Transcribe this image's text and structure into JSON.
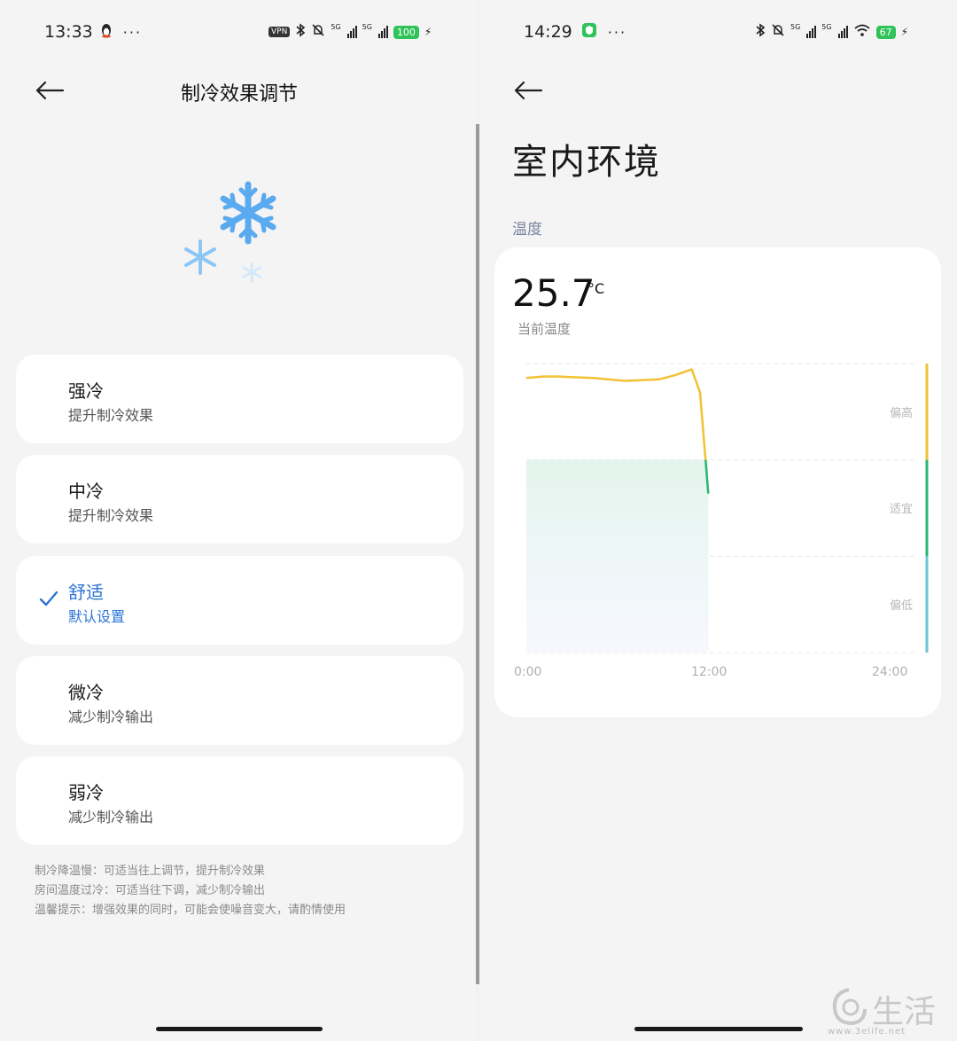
{
  "left": {
    "status": {
      "time": "13:33",
      "vpn": "VPN",
      "net1": "5G",
      "net2": "5G",
      "battery": "100"
    },
    "title": "制冷效果调节",
    "options": [
      {
        "title": "强冷",
        "subtitle": "提升制冷效果",
        "selected": false
      },
      {
        "title": "中冷",
        "subtitle": "提升制冷效果",
        "selected": false
      },
      {
        "title": "舒适",
        "subtitle": "默认设置",
        "selected": true
      },
      {
        "title": "微冷",
        "subtitle": "减少制冷输出",
        "selected": false
      },
      {
        "title": "弱冷",
        "subtitle": "减少制冷输出",
        "selected": false
      }
    ],
    "tips": [
      "制冷降温慢：可适当往上调节，提升制冷效果",
      "房间温度过冷：可适当往下调，减少制冷输出",
      "温馨提示：增强效果的同时，可能会使噪音变大，请酌情使用"
    ],
    "accent": "#2b74d6"
  },
  "right": {
    "status": {
      "time": "14:29",
      "net1": "5G",
      "net2": "5G",
      "battery": "67"
    },
    "title": "室内环境",
    "section": "温度",
    "current_temp": "25.7",
    "unit": "°C",
    "caption": "当前温度",
    "bands": [
      "偏高",
      "适宜",
      "偏低"
    ],
    "x_ticks": [
      "0:00",
      "12:00",
      "24:00"
    ],
    "colors": {
      "high": "#f1c232",
      "ok": "#2bb673",
      "low": "#6cc6d8"
    }
  },
  "chart_data": {
    "type": "line",
    "x": [
      "0:00",
      "1:00",
      "2:00",
      "4:00",
      "6:00",
      "8:00",
      "9:00",
      "10:00",
      "10:30",
      "11:00"
    ],
    "series": [
      {
        "values": [
          0.95,
          0.955,
          0.955,
          0.95,
          0.94,
          0.945,
          0.96,
          0.98,
          0.9,
          0.55
        ]
      }
    ],
    "x_range": [
      "0:00",
      "24:00"
    ],
    "bands": [
      "偏高",
      "适宜",
      "偏低"
    ],
    "grid": true
  },
  "watermark": {
    "text": "生活",
    "url": "www.3elife.net"
  }
}
